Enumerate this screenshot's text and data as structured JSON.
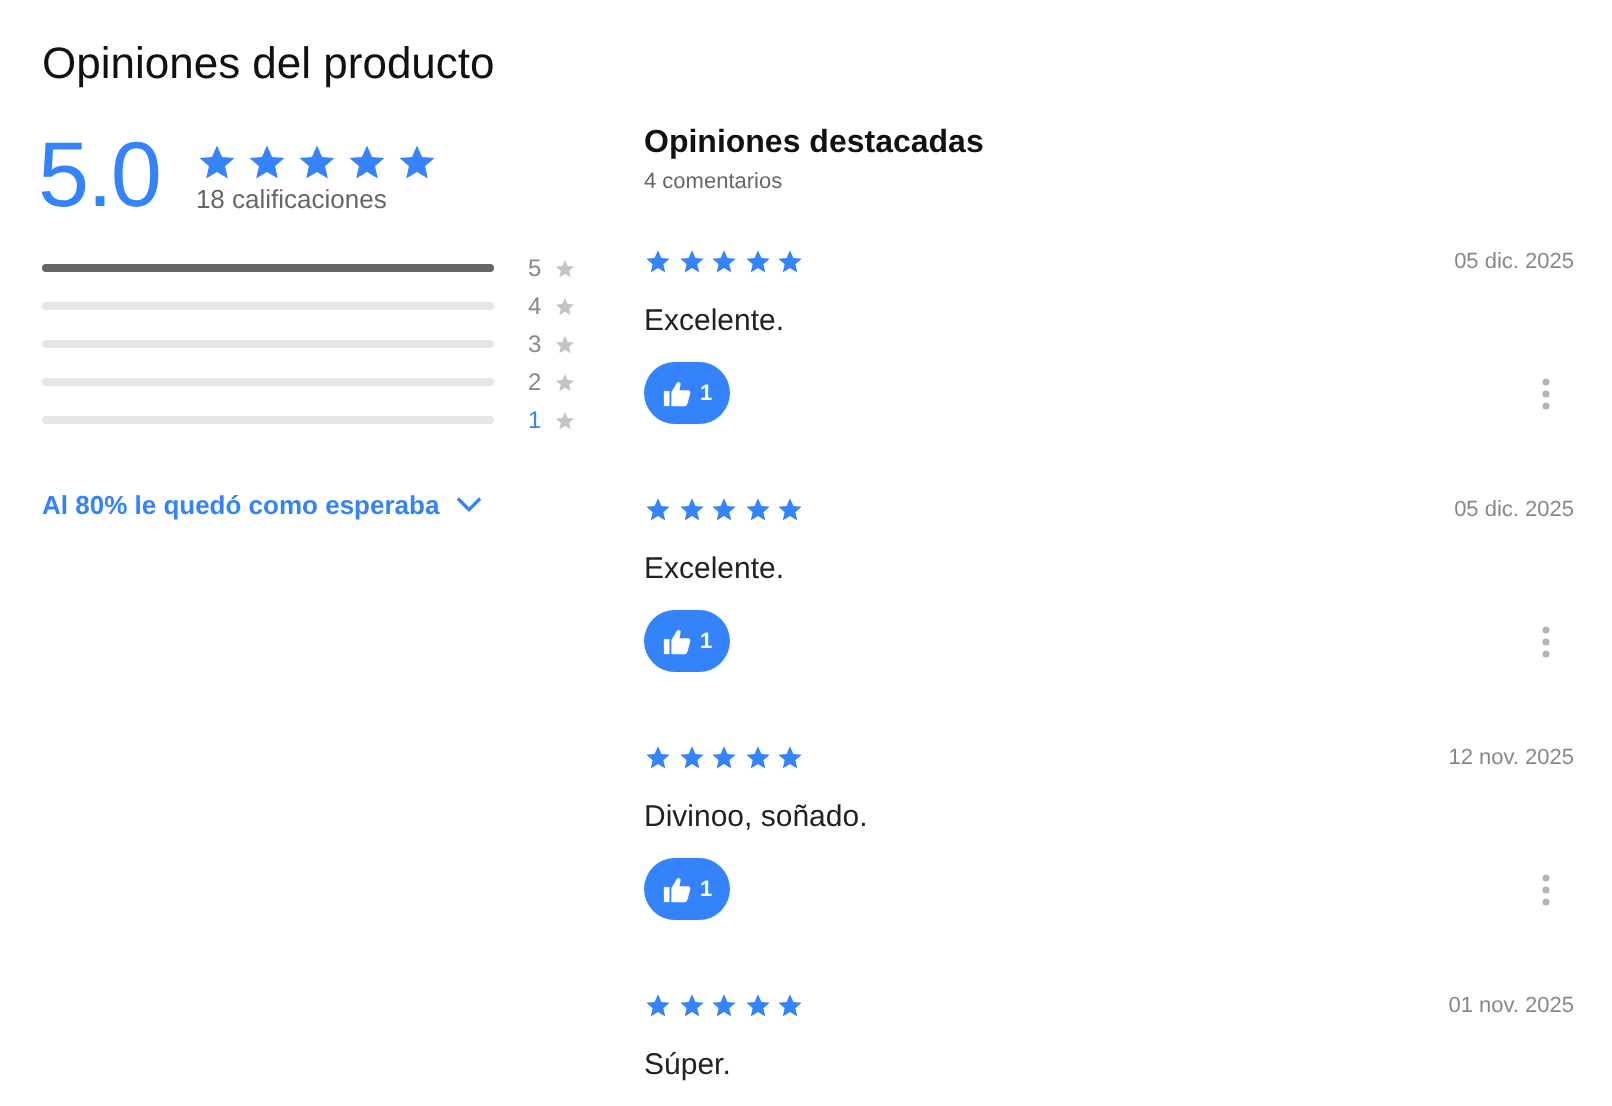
{
  "title": "Opiniones del producto",
  "summary": {
    "score": "5.0",
    "stars": 5,
    "count": "18 calificaciones"
  },
  "distribution": [
    {
      "label": "5",
      "level": 1,
      "highlighted": false
    },
    {
      "label": "4",
      "level": 0,
      "highlighted": false
    },
    {
      "label": "3",
      "level": 0,
      "highlighted": false
    },
    {
      "label": "2",
      "level": 0,
      "highlighted": false
    },
    {
      "label": "1",
      "level": 0,
      "highlighted": true
    }
  ],
  "expectation_link": "Al 80% le quedó como esperaba",
  "featured": {
    "heading": "Opiniones destacadas",
    "count": "4 comentarios"
  },
  "reviews": [
    {
      "stars": 5,
      "date": "05 dic. 2025",
      "text": "Excelente.",
      "likes": "1"
    },
    {
      "stars": 5,
      "date": "05 dic. 2025",
      "text": "Excelente.",
      "likes": "1"
    },
    {
      "stars": 5,
      "date": "12 nov. 2025",
      "text": "Divinoo, soñado.",
      "likes": "1"
    },
    {
      "stars": 5,
      "date": "01 nov. 2025",
      "text": "Súper."
    }
  ]
}
